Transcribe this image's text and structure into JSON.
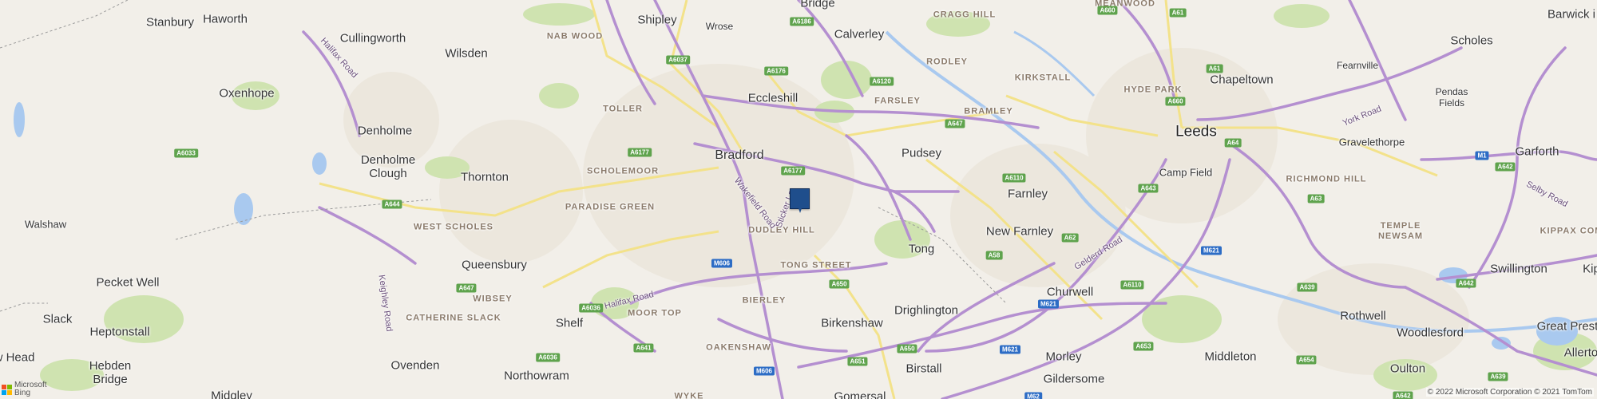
{
  "map": {
    "provider_logo": {
      "line1": "Microsoft",
      "line2": "Bing",
      "icon": "microsoft-logo-icon",
      "colors": [
        "#f25022",
        "#7fba00",
        "#00a4ef",
        "#ffb900"
      ]
    },
    "copyright": "© 2022 Microsoft Corporation © 2021 TomTom",
    "marker": {
      "icon": "location-marker-icon",
      "color": "#1f4e8c"
    },
    "colors": {
      "background": "#f2efe9",
      "woodland": "#cfe3b0",
      "water": "#a9c9ef",
      "motorway_road": "#b48fd0",
      "a_road": "#f3e28a",
      "urban": "#ece7dd",
      "shield_a": "#5fa34d",
      "shield_m": "#2c6cc5"
    },
    "cities": [
      {
        "name": "Leeds"
      }
    ],
    "towns": [
      {
        "name": "Stanbury"
      },
      {
        "name": "Haworth"
      },
      {
        "name": "Shipley"
      },
      {
        "name": "Wrose"
      },
      {
        "name": "Bridge"
      },
      {
        "name": "Calverley"
      },
      {
        "name": "Cullingworth"
      },
      {
        "name": "Wilsden"
      },
      {
        "name": "Eccleshill"
      },
      {
        "name": "Oxenhope"
      },
      {
        "name": "Denholme"
      },
      {
        "name": "Bradford"
      },
      {
        "name": "Pudsey"
      },
      {
        "name": "Chapeltown"
      },
      {
        "name": "Scholes"
      },
      {
        "name": "Fearnville"
      },
      {
        "name": "Barwick i"
      },
      {
        "name": "Pendas Fields"
      },
      {
        "name": "Denholme Clough"
      },
      {
        "name": "Thornton"
      },
      {
        "name": "Farnley"
      },
      {
        "name": "Camp Field"
      },
      {
        "name": "Gravelethorpe"
      },
      {
        "name": "Garforth"
      },
      {
        "name": "Walshaw"
      },
      {
        "name": "New Farnley"
      },
      {
        "name": "Tong"
      },
      {
        "name": "Queensbury"
      },
      {
        "name": "Swillington"
      },
      {
        "name": "Kip"
      },
      {
        "name": "Pecket Well"
      },
      {
        "name": "Churwell"
      },
      {
        "name": "Drighlington"
      },
      {
        "name": "Slack"
      },
      {
        "name": "Heptonstall"
      },
      {
        "name": "Shelf"
      },
      {
        "name": "Birkenshaw"
      },
      {
        "name": "Rothwell"
      },
      {
        "name": "Woodlesford"
      },
      {
        "name": "Great Prest"
      },
      {
        "name": "Morley"
      },
      {
        "name": "Hebden Bridge"
      },
      {
        "name": "Ovenden"
      },
      {
        "name": "Birstall"
      },
      {
        "name": "Middleton"
      },
      {
        "name": "Oulton"
      },
      {
        "name": "Allerto"
      },
      {
        "name": "w Head"
      },
      {
        "name": "Northowram"
      },
      {
        "name": "Gildersome"
      },
      {
        "name": "Midgley"
      },
      {
        "name": "Gomersal"
      }
    ],
    "districts": [
      {
        "name": "CRAGG HILL"
      },
      {
        "name": "MEANWOOD"
      },
      {
        "name": "NAB WOOD"
      },
      {
        "name": "RODLEY"
      },
      {
        "name": "KIRKSTALL"
      },
      {
        "name": "HYDE PARK"
      },
      {
        "name": "TOLLER"
      },
      {
        "name": "FARSLEY"
      },
      {
        "name": "BRAMLEY"
      },
      {
        "name": "SCHOLEMOOR"
      },
      {
        "name": "RICHMOND HILL"
      },
      {
        "name": "PARADISE GREEN"
      },
      {
        "name": "WEST SCHOLES"
      },
      {
        "name": "DUDLEY HILL"
      },
      {
        "name": "TEMPLE NEWSAM"
      },
      {
        "name": "KIPPAX COM"
      },
      {
        "name": "TONG STREET"
      },
      {
        "name": "WIBSEY"
      },
      {
        "name": "BIERLEY"
      },
      {
        "name": "CATHERINE SLACK"
      },
      {
        "name": "MOOR TOP"
      },
      {
        "name": "OAKENSHAW"
      },
      {
        "name": "WYKE"
      }
    ],
    "road_names": [
      {
        "name": "Halifax Road"
      },
      {
        "name": "Keighley Road"
      },
      {
        "name": "Wakefield Road"
      },
      {
        "name": "Sticker La"
      },
      {
        "name": "Halifax Road"
      },
      {
        "name": "Gelderd Road"
      },
      {
        "name": "York Road"
      },
      {
        "name": "Selby Road"
      }
    ],
    "shields": [
      {
        "ref": "A6037",
        "type": "a"
      },
      {
        "ref": "A6176",
        "type": "a"
      },
      {
        "ref": "A6120",
        "type": "a"
      },
      {
        "ref": "A660",
        "type": "a"
      },
      {
        "ref": "A61",
        "type": "a"
      },
      {
        "ref": "A660",
        "type": "a"
      },
      {
        "ref": "A6177",
        "type": "a"
      },
      {
        "ref": "A647",
        "type": "a"
      },
      {
        "ref": "A6033",
        "type": "a"
      },
      {
        "ref": "A6177",
        "type": "a"
      },
      {
        "ref": "A64",
        "type": "a"
      },
      {
        "ref": "M1",
        "type": "m"
      },
      {
        "ref": "A642",
        "type": "a"
      },
      {
        "ref": "A6110",
        "type": "a"
      },
      {
        "ref": "A643",
        "type": "a"
      },
      {
        "ref": "A63",
        "type": "a"
      },
      {
        "ref": "A644",
        "type": "a"
      },
      {
        "ref": "A62",
        "type": "a"
      },
      {
        "ref": "A58",
        "type": "a"
      },
      {
        "ref": "M621",
        "type": "m"
      },
      {
        "ref": "M606",
        "type": "m"
      },
      {
        "ref": "A650",
        "type": "a"
      },
      {
        "ref": "A647",
        "type": "a"
      },
      {
        "ref": "A6110",
        "type": "a"
      },
      {
        "ref": "A639",
        "type": "a"
      },
      {
        "ref": "A642",
        "type": "a"
      },
      {
        "ref": "A6036",
        "type": "a"
      },
      {
        "ref": "M621",
        "type": "m"
      },
      {
        "ref": "A641",
        "type": "a"
      },
      {
        "ref": "A650",
        "type": "a"
      },
      {
        "ref": "M621",
        "type": "m"
      },
      {
        "ref": "A6036",
        "type": "a"
      },
      {
        "ref": "A651",
        "type": "a"
      },
      {
        "ref": "A653",
        "type": "a"
      },
      {
        "ref": "A654",
        "type": "a"
      },
      {
        "ref": "M606",
        "type": "m"
      },
      {
        "ref": "A639",
        "type": "a"
      },
      {
        "ref": "M62",
        "type": "m"
      },
      {
        "ref": "A642",
        "type": "a"
      },
      {
        "ref": "A6186",
        "type": "a"
      },
      {
        "ref": "A61",
        "type": "a"
      }
    ]
  }
}
